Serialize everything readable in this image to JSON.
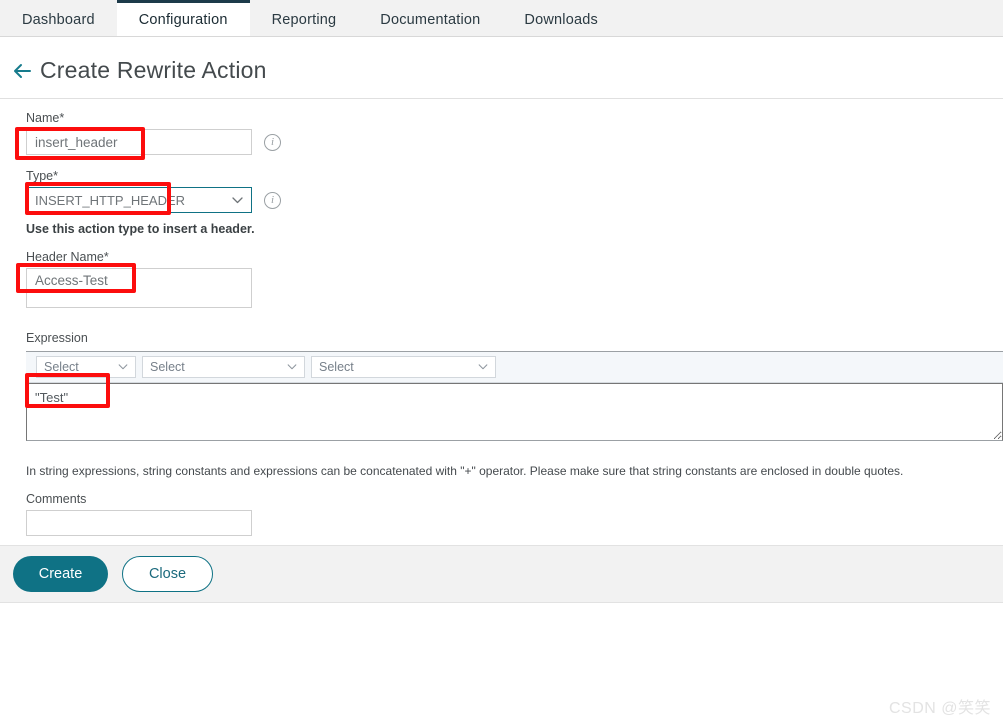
{
  "nav": {
    "tabs": [
      {
        "label": "Dashboard",
        "active": false
      },
      {
        "label": "Configuration",
        "active": true
      },
      {
        "label": "Reporting",
        "active": false
      },
      {
        "label": "Documentation",
        "active": false
      },
      {
        "label": "Downloads",
        "active": false
      }
    ]
  },
  "header": {
    "back_icon": "arrow-left-icon",
    "title": "Create Rewrite Action"
  },
  "form": {
    "name": {
      "label": "Name*",
      "value": "insert_header",
      "info_icon": "info-circle-icon"
    },
    "type": {
      "label": "Type*",
      "value": "INSERT_HTTP_HEADER",
      "chevron_icon": "chevron-down-icon",
      "info_icon": "info-circle-icon",
      "helper": "Use this action type to insert a header."
    },
    "header_name": {
      "label": "Header Name*",
      "value": "Access-Test"
    },
    "expression": {
      "label": "Expression",
      "selectors": [
        {
          "value": "Select",
          "chevron_icon": "chevron-down-icon"
        },
        {
          "value": "Select",
          "chevron_icon": "chevron-down-icon"
        },
        {
          "value": "Select",
          "chevron_icon": "chevron-down-icon"
        }
      ],
      "editor_value": "\"Test\"",
      "note": "In string expressions, string constants and expressions can be concatenated with \"+\" operator. Please make sure that string constants are enclosed in double quotes."
    },
    "comments": {
      "label": "Comments",
      "value": ""
    }
  },
  "footer": {
    "create_label": "Create",
    "close_label": "Close"
  },
  "watermark": "CSDN @笑笑",
  "colors": {
    "accent_teal": "#0f7285",
    "annotation_red": "#fc0d0d",
    "tabbar_bg": "#f2f2f2",
    "footer_bg": "#f2f2f2"
  }
}
